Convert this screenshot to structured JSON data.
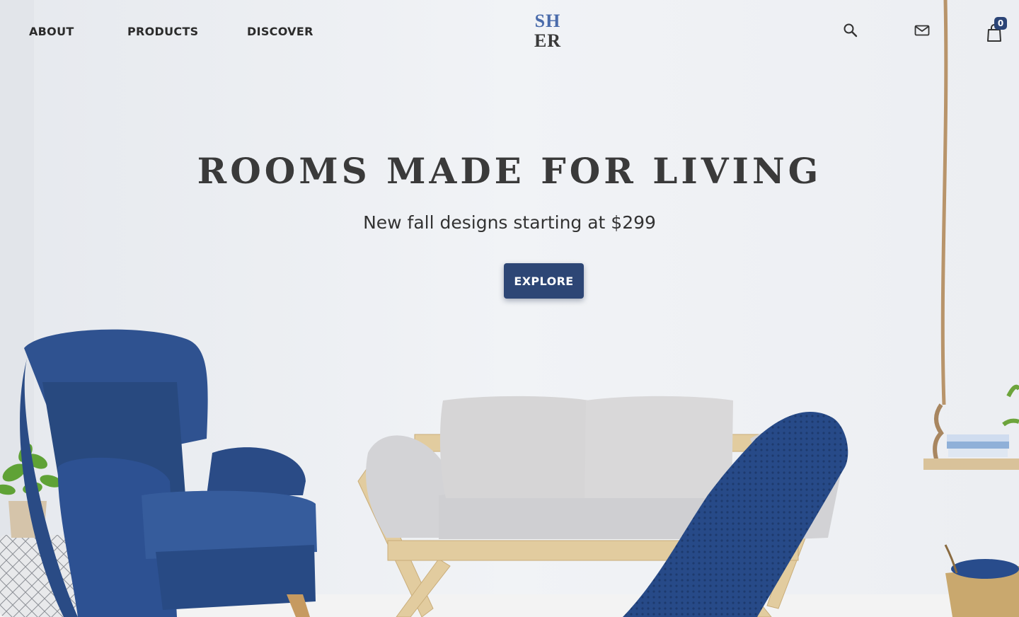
{
  "nav": {
    "items": [
      {
        "label": "ABOUT"
      },
      {
        "label": "PRODUCTS"
      },
      {
        "label": "DISCOVER"
      }
    ]
  },
  "logo": {
    "line1": "SH",
    "line2": "ER"
  },
  "header_icons": {
    "search": "search-icon",
    "mail": "mail-icon",
    "cart": "shopping-bag-icon",
    "cart_count": "0"
  },
  "hero": {
    "title": "ROOMS MADE FOR LIVING",
    "subtitle": "New fall designs starting at $299",
    "cta_label": "EXPLORE"
  },
  "colors": {
    "accent": "#2d4675",
    "logo_blue": "#4a6bab",
    "text_dark": "#3a3a3a"
  }
}
